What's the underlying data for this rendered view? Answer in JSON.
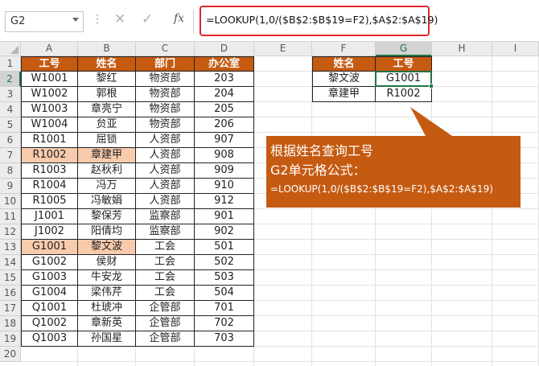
{
  "formula_bar": {
    "name_box": "G2",
    "dots": "⋮",
    "cancel_icon": "✕",
    "enter_icon": "✓",
    "fx_label": "fx",
    "formula": "=LOOKUP(1,0/($B$2:$B$19=F2),$A$2:$A$19)"
  },
  "columns": [
    "A",
    "B",
    "C",
    "D",
    "E",
    "F",
    "G",
    "H",
    "I"
  ],
  "rows": [
    "1",
    "2",
    "3",
    "4",
    "5",
    "6",
    "7",
    "8",
    "9",
    "10",
    "11",
    "12",
    "13",
    "14",
    "15",
    "16",
    "17",
    "18",
    "19",
    "20"
  ],
  "table": {
    "headers": [
      "工号",
      "姓名",
      "部门",
      "办公室"
    ],
    "rows": [
      [
        "W1001",
        "黎红",
        "物资部",
        "203"
      ],
      [
        "W1002",
        "郭根",
        "物资部",
        "204"
      ],
      [
        "W1003",
        "章亮宁",
        "物资部",
        "205"
      ],
      [
        "W1004",
        "贠亚",
        "物资部",
        "206"
      ],
      [
        "R1001",
        "屈锁",
        "人资部",
        "907"
      ],
      [
        "R1002",
        "章建甲",
        "人资部",
        "908"
      ],
      [
        "R1003",
        "赵秋利",
        "人资部",
        "909"
      ],
      [
        "R1004",
        "冯万",
        "人资部",
        "910"
      ],
      [
        "R1005",
        "冯敏娟",
        "人资部",
        "912"
      ],
      [
        "J1001",
        "黎保芳",
        "监察部",
        "901"
      ],
      [
        "J1002",
        "阳倩均",
        "监察部",
        "902"
      ],
      [
        "G1001",
        "黎文波",
        "工会",
        "501"
      ],
      [
        "G1002",
        "侯财",
        "工会",
        "502"
      ],
      [
        "G1003",
        "牛安龙",
        "工会",
        "503"
      ],
      [
        "G1004",
        "梁伟芹",
        "工会",
        "504"
      ],
      [
        "Q1001",
        "杜琥冲",
        "企管部",
        "701"
      ],
      [
        "Q1002",
        "章新英",
        "企管部",
        "702"
      ],
      [
        "Q1003",
        "孙国星",
        "企管部",
        "703"
      ]
    ],
    "highlighted_rows": [
      6,
      12
    ]
  },
  "lookup": {
    "headers": [
      "姓名",
      "工号"
    ],
    "rows": [
      [
        "黎文波",
        "G1001"
      ],
      [
        "章建甲",
        "R1002"
      ]
    ]
  },
  "callout": {
    "line1": "根据姓名查询工号",
    "line2": "G2单元格公式：",
    "line3": "=LOOKUP(1,0/($B$2:$B$19=F2),$A$2:$A$19)"
  },
  "colors": {
    "header_fill": "#c55a11",
    "highlight_fill": "#f8cbad",
    "callout_fill": "#c55a11",
    "formula_border": "#e0272a",
    "selection": "#217346"
  },
  "selected_cell": "G2"
}
